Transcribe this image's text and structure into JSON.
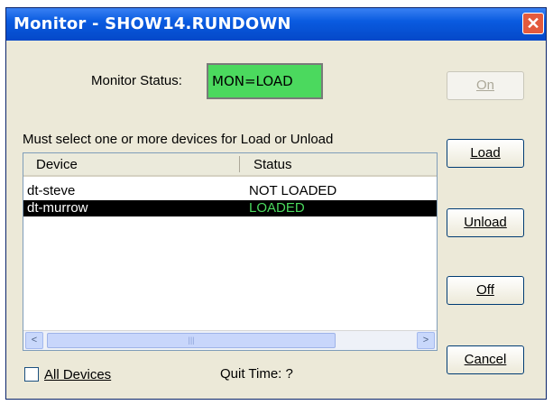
{
  "window": {
    "title": "Monitor - SHOW14.RUNDOWN",
    "close_symbol": "✕"
  },
  "monitor_status": {
    "label": "Monitor Status:",
    "value": "MON=LOAD",
    "color": "#4bd95e"
  },
  "instruction": "Must select one or more devices for Load or Unload",
  "list": {
    "columns": [
      "Device",
      "Status"
    ],
    "rows": [
      {
        "device": "dt-steve",
        "status": "NOT LOADED",
        "selected": false
      },
      {
        "device": "dt-murrow",
        "status": "LOADED",
        "selected": true
      }
    ],
    "scroll_left": "<",
    "scroll_right": ">",
    "scroll_grip": "|||"
  },
  "all_devices": {
    "label": "All Devices",
    "checked": false
  },
  "quit_time": "Quit Time: ?",
  "buttons": {
    "on": "On",
    "load": "Load",
    "unload": "Unload",
    "off": "Off",
    "cancel": "Cancel"
  }
}
